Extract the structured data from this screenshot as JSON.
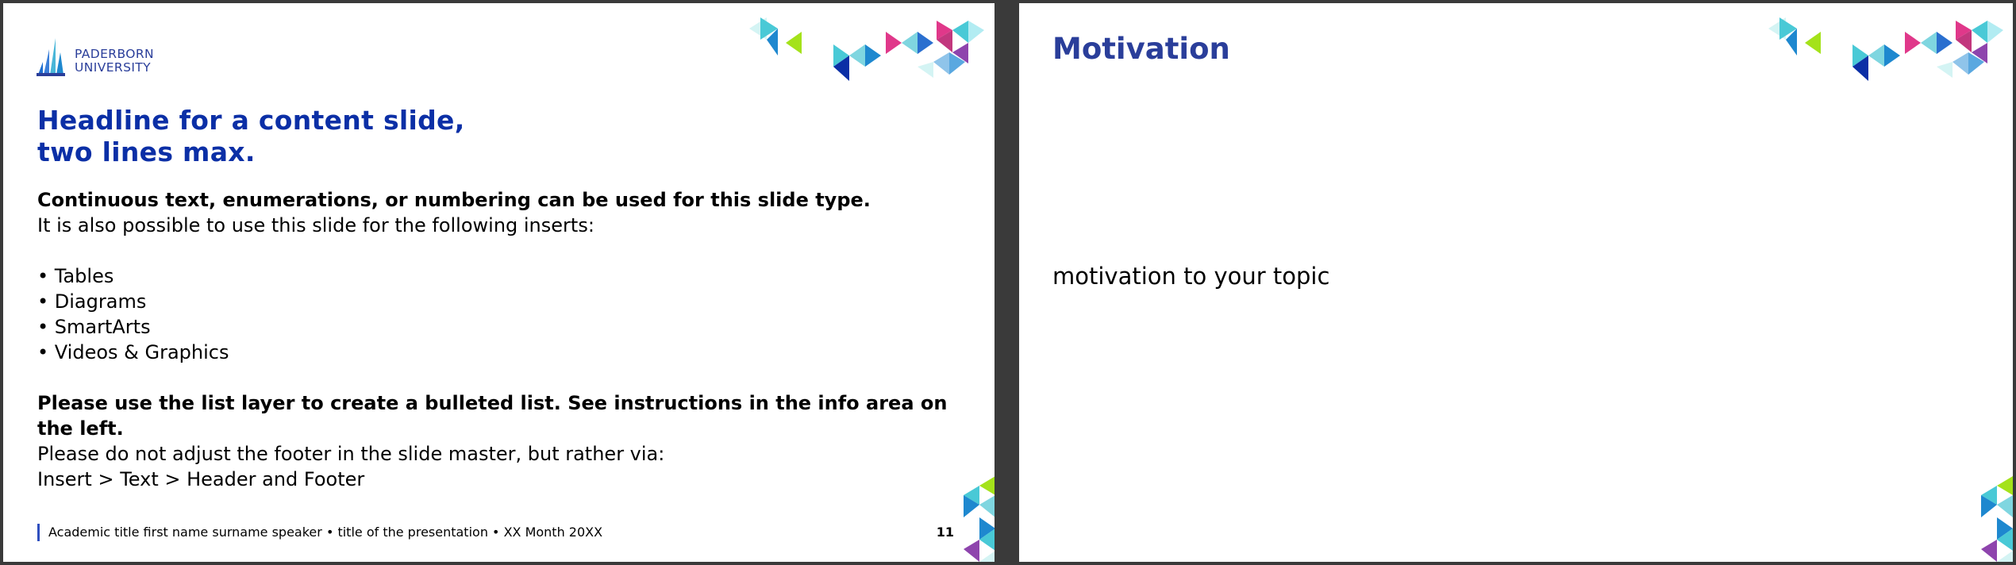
{
  "slides": [
    {
      "logo": {
        "line1": "PADERBORN",
        "line2": "UNIVERSITY"
      },
      "title": {
        "line1": "Headline for a content slide,",
        "line2": "two lines max."
      },
      "intro_bold": "Continuous text, enumerations, or numbering can be used for this slide type.",
      "intro": "It is also possible to use this slide for the following inserts:",
      "bullets": [
        "• Tables",
        "• Diagrams",
        "• SmartArts",
        "• Videos & Graphics"
      ],
      "note_bold": "Please use the list layer to create a bulleted list. See instructions in the info area on the left.",
      "note_line1": "Please do not adjust the footer in the slide master, but rather via:",
      "note_line2": "Insert > Text > Header and Footer",
      "footer": "Academic title first name surname speaker • title of the presentation • XX Month 20XX",
      "page_number": "11"
    },
    {
      "title": "Motivation",
      "body": "motivation to your topic"
    }
  ],
  "colors": {
    "brand_blue": "#0b2fa6",
    "title_blue": "#2a3e9a",
    "deco": [
      "#d4f4f4",
      "#49c9d6",
      "#1e88cf",
      "#0b2fa6",
      "#a4e21a",
      "#e0388a",
      "#8e44ad",
      "#2a6fcf",
      "#7fd6e0"
    ]
  }
}
